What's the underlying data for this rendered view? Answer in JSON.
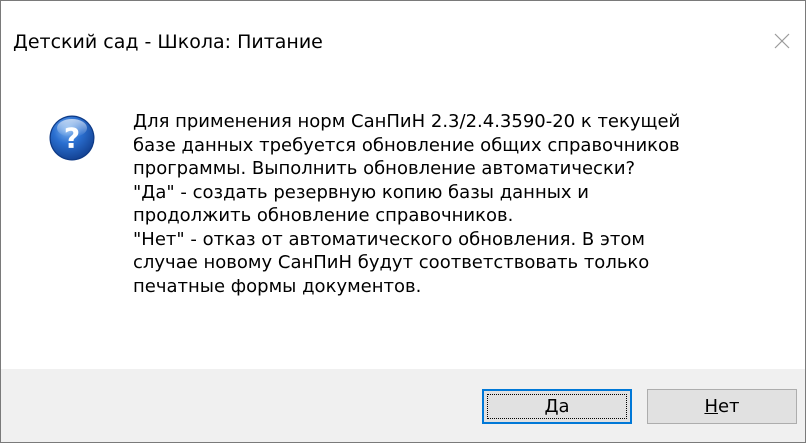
{
  "window": {
    "title": "Детский сад - Школа: Питание",
    "close_icon": "close-icon"
  },
  "message": {
    "icon": "question-icon",
    "lines": [
      "Для применения норм СанПиН 2.3/2.4.3590-20 к текущей",
      "базе данных требуется обновление общих справочников",
      "программы. Выполнить обновление автоматически?",
      "\"Да\" - создать резервную копию базы данных и",
      "продолжить обновление справочников.",
      "\"Нет\" - отказ от автоматического обновления. В этом",
      "случае новому СанПиН будут соответствовать только",
      "печатные формы документов."
    ]
  },
  "buttons": {
    "yes": {
      "accel": "Д",
      "rest": "а"
    },
    "no": {
      "accel": "Н",
      "rest": "ет"
    }
  },
  "colors": {
    "footer_bg": "#f0f0f0",
    "focus_border": "#0078d7",
    "button_bg": "#e1e1e1",
    "icon_blue": "#1c5fb8"
  }
}
